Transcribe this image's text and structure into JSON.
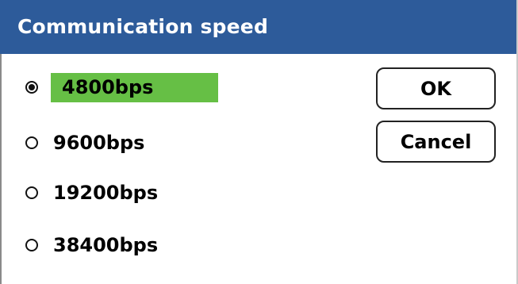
{
  "dialog": {
    "title": "Communication speed"
  },
  "options": [
    {
      "label": "4800bps",
      "selected": true
    },
    {
      "label": "9600bps",
      "selected": false
    },
    {
      "label": "19200bps",
      "selected": false
    },
    {
      "label": "38400bps",
      "selected": false
    }
  ],
  "buttons": {
    "ok_label": "OK",
    "cancel_label": "Cancel"
  },
  "colors": {
    "titlebar": "#2d5b9a",
    "selection_highlight": "#66bf45"
  }
}
